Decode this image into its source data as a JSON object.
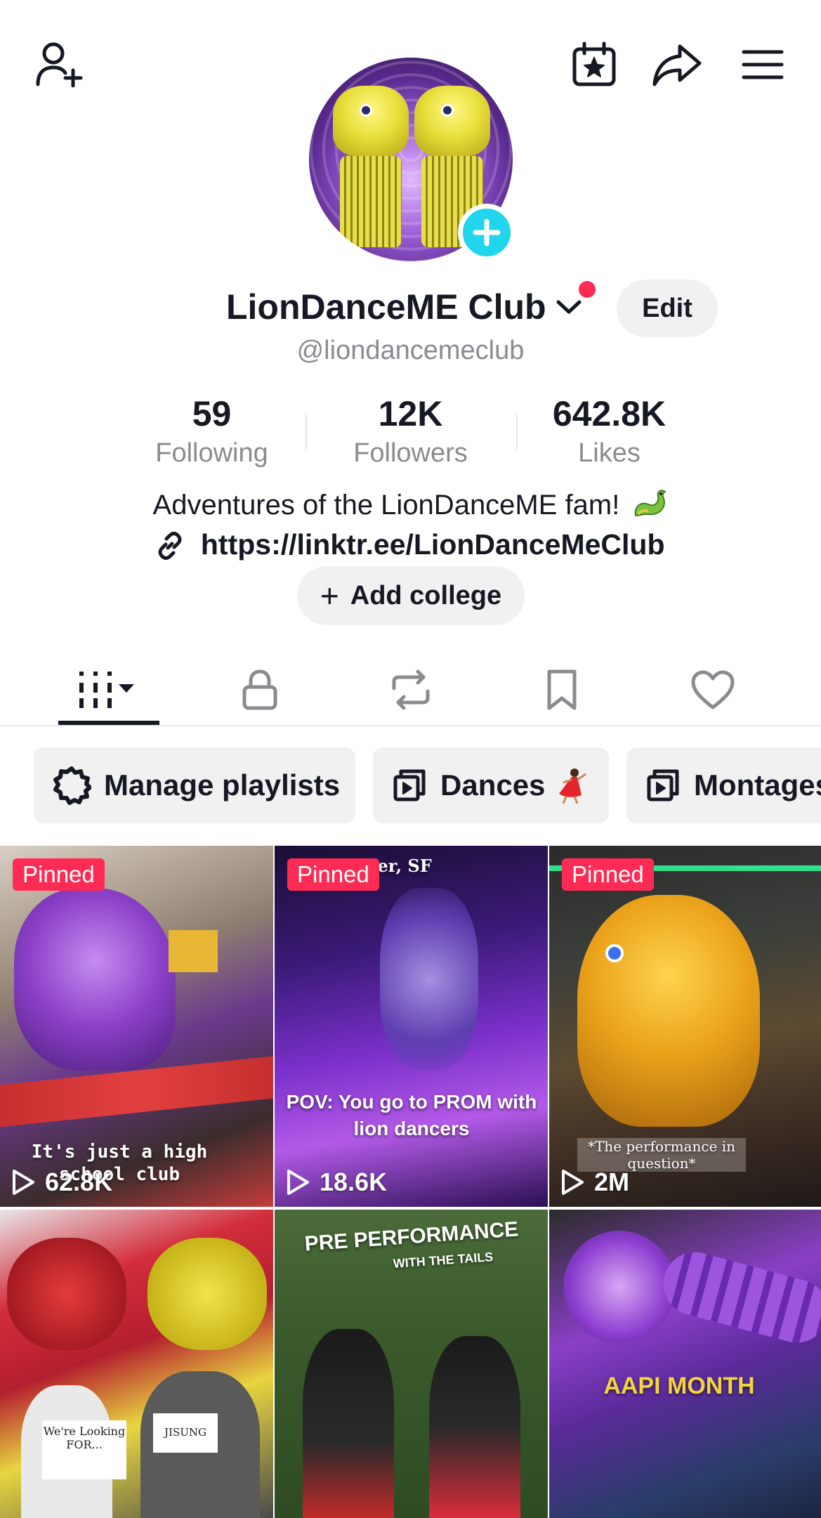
{
  "profile": {
    "name": "LionDanceME Club",
    "handle": "@liondancemeclub",
    "edit_label": "Edit",
    "bio": "Adventures of the LionDanceME fam!",
    "link": "https://linktr.ee/LionDanceMeClub",
    "add_college_label": "Add college"
  },
  "stats": [
    {
      "value": "59",
      "label": "Following"
    },
    {
      "value": "12K",
      "label": "Followers"
    },
    {
      "value": "642.8K",
      "label": "Likes"
    }
  ],
  "tabs": [
    {
      "icon": "grid-icon",
      "active": true
    },
    {
      "icon": "lock-icon",
      "active": false
    },
    {
      "icon": "repost-icon",
      "active": false
    },
    {
      "icon": "bookmark-icon",
      "active": false
    },
    {
      "icon": "heart-icon",
      "active": false
    }
  ],
  "chips": [
    {
      "label": "Manage playlists",
      "icon": "settings-icon"
    },
    {
      "label": "Dances",
      "icon": "playlist-icon"
    },
    {
      "label": "Montages",
      "icon": "playlist-icon"
    }
  ],
  "videos": [
    {
      "pinned": "Pinned",
      "views": "62.8K",
      "caption": "It's just a high school club"
    },
    {
      "pinned": "Pinned",
      "views": "18.6K",
      "caption": "POV: You go to PROM with lion dancers",
      "top_text": "e Center, SF"
    },
    {
      "pinned": "Pinned",
      "views": "2M",
      "caption": "*The performance in question*"
    },
    {
      "caption": "We're Looking FOR...",
      "caption2": "JISUNG"
    },
    {
      "caption": "PRE PERFORMANCE",
      "caption2": "WITH THE TAILS"
    },
    {
      "caption": "AAPI MONTH"
    }
  ],
  "colors": {
    "accent": "#fe2c55",
    "badge": "#20d5ec",
    "text": "#161823",
    "muted": "#8a8b91",
    "chip_bg": "#f1f1f2"
  }
}
